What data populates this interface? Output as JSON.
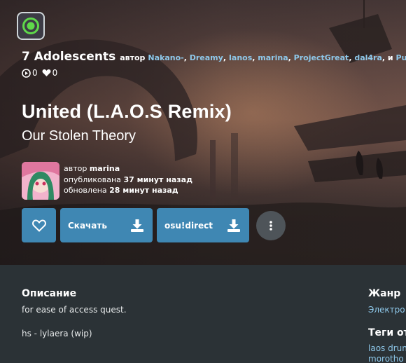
{
  "beatmap": {
    "difficulty": "7 Adolescents",
    "by_word": "автор",
    "mappers": [
      "Nakano-",
      "Dreamy",
      "Ianos",
      "marina",
      "ProjectGreat",
      "dal4ra"
    ],
    "and_word": ", и",
    "last_mapper": "Purl",
    "plays": "0",
    "favourites": "0",
    "title": "United (L.A.O.S Remix)",
    "artist": "Our Stolen Theory"
  },
  "creator": {
    "by_word": "автор",
    "name": "marina",
    "published_label": "опубликована",
    "published_value": "37 минут назад",
    "updated_label": "обновлена",
    "updated_value": "28 минут назад"
  },
  "actions": {
    "download_label": "Скачать",
    "direct_label": "osu!direct"
  },
  "info": {
    "description_heading": "Описание",
    "description_line1": "for ease of access quest.",
    "description_line2": "hs - lylaera (wip)",
    "genre_heading": "Жанр",
    "genre_value": "Электро",
    "tags_heading": "Теги от",
    "tags_line1": "laos drun",
    "tags_line2": "morotho"
  },
  "colors": {
    "accent_blue": "#3f87b3",
    "link_blue": "#8ec8ea",
    "panel_bg": "#2b3236",
    "ruleset_green": "#5fd84a"
  },
  "icons": {
    "ruleset": "osu-ruleset-icon",
    "play": "play-count-icon",
    "heart": "heart-icon",
    "download": "download-icon",
    "more": "more-vertical-icon"
  }
}
